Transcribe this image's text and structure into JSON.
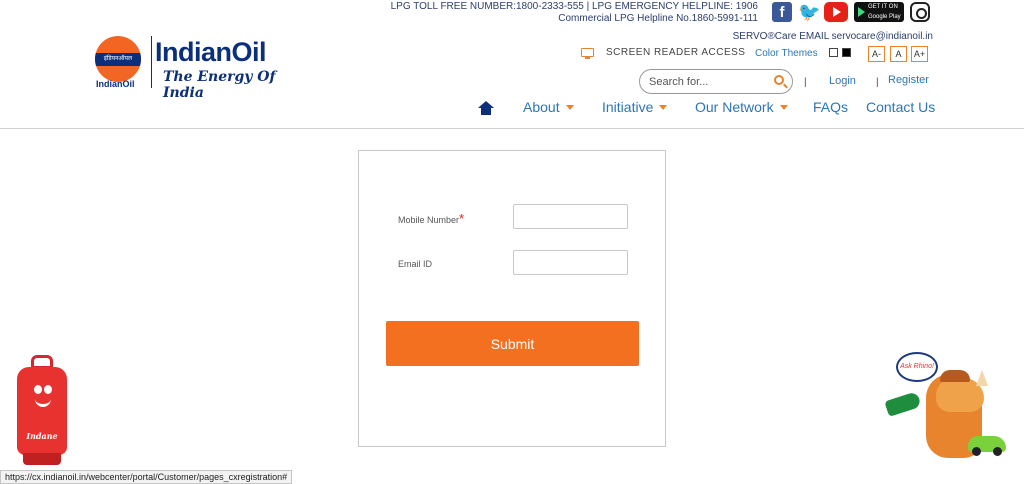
{
  "brand": {
    "logo_hindi": "इंडियनऑयल",
    "logo_small": "IndianOil",
    "name": "IndianOil",
    "tagline": "The Energy Of India"
  },
  "top_info": {
    "line1": "LPG TOLL FREE NUMBER:1800-2333-555 | LPG EMERGENCY HELPLINE: 1906",
    "line2": "Commercial LPG Helpline No.1860-5991-111"
  },
  "social": {
    "facebook": "f",
    "twitter": "🐦",
    "google_play": "GET IT ON Google Play"
  },
  "servo": "SERVO®Care EMAIL servocare@indianoil.in",
  "accessibility": {
    "screen_reader": "SCREEN READER ACCESS",
    "color_themes": "Color Themes",
    "font_small": "A-",
    "font_normal": "A",
    "font_large": "A+"
  },
  "search": {
    "placeholder": "Search for..."
  },
  "account": {
    "separator": "|",
    "login": "Login",
    "register": "Register"
  },
  "nav": {
    "about": "About",
    "initiative": "Initiative",
    "our_network": "Our Network",
    "faqs": "FAQs",
    "contact": "Contact Us"
  },
  "form": {
    "mobile_label": "Mobile Number",
    "required_mark": "*",
    "mobile_value": "",
    "email_label": "Email ID",
    "email_value": "",
    "submit": "Submit"
  },
  "mascots": {
    "indane": "Indane",
    "bubble": "Ask Rhino!"
  },
  "status_url": "https://cx.indianoil.in/webcenter/portal/Customer/pages_cxregistration#",
  "colors": {
    "brand_blue": "#0b2f7a",
    "accent_orange": "#f37021",
    "link_blue": "#2e75b6"
  },
  "icons": [
    "facebook-icon",
    "twitter-icon",
    "youtube-icon",
    "google-play-icon",
    "instagram-icon",
    "monitor-icon",
    "search-icon",
    "home-icon",
    "chevron-down-icon"
  ]
}
